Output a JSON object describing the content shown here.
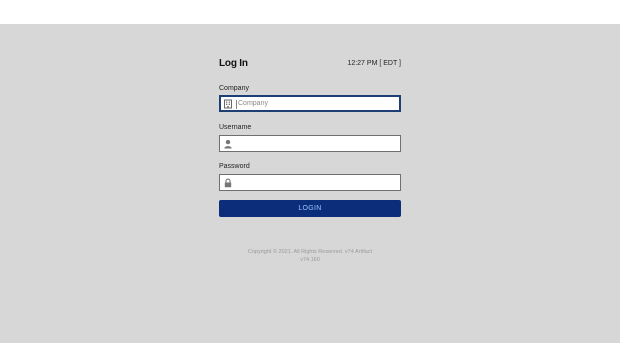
{
  "header": {
    "title": "Log In",
    "clock": "12:27 PM [ EDT ]"
  },
  "fields": {
    "company": {
      "label": "Company",
      "placeholder": "Company",
      "value": "",
      "icon": "building-icon"
    },
    "username": {
      "label": "Username",
      "placeholder": "",
      "value": "",
      "icon": "user-icon"
    },
    "password": {
      "label": "Password",
      "placeholder": "",
      "value": "",
      "icon": "lock-icon"
    }
  },
  "login_button": {
    "label": "LOGIN"
  },
  "footer": {
    "copyright_line1": "Copyright © 2021. All Rights Reserved. v74 Artifact",
    "copyright_line2": "v74.160"
  },
  "colors": {
    "background": "#d7d7d7",
    "button": "#0c2e7a",
    "button_text": "#9cc3ff",
    "focus_border": "#1e3f73"
  }
}
